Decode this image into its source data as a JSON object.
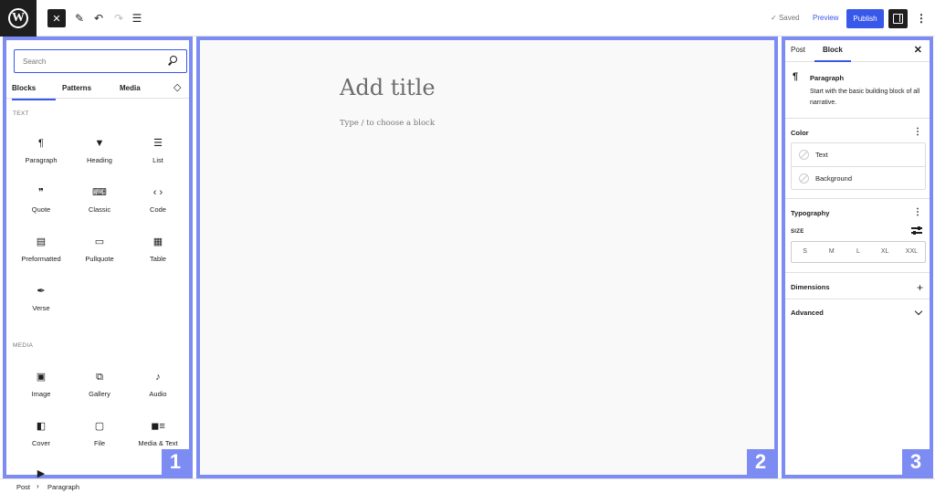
{
  "header": {
    "status": "Saved",
    "preview_label": "Preview",
    "publish_label": "Publish"
  },
  "inserter": {
    "search_placeholder": "Search",
    "tabs": [
      "Blocks",
      "Patterns",
      "Media"
    ],
    "sections": [
      {
        "title": "TEXT",
        "blocks": [
          {
            "label": "Paragraph",
            "icon": "paragraph-icon"
          },
          {
            "label": "Heading",
            "icon": "heading-icon"
          },
          {
            "label": "List",
            "icon": "list-icon"
          },
          {
            "label": "Quote",
            "icon": "quote-icon"
          },
          {
            "label": "Classic",
            "icon": "classic-keyboard-icon"
          },
          {
            "label": "Code",
            "icon": "code-icon"
          },
          {
            "label": "Preformatted",
            "icon": "preformatted-icon"
          },
          {
            "label": "Pullquote",
            "icon": "pullquote-icon"
          },
          {
            "label": "Table",
            "icon": "table-icon"
          },
          {
            "label": "Verse",
            "icon": "verse-quill-icon"
          }
        ]
      },
      {
        "title": "MEDIA",
        "blocks": [
          {
            "label": "Image",
            "icon": "image-icon"
          },
          {
            "label": "Gallery",
            "icon": "gallery-icon"
          },
          {
            "label": "Audio",
            "icon": "audio-note-icon"
          },
          {
            "label": "Cover",
            "icon": "cover-icon"
          },
          {
            "label": "File",
            "icon": "file-folder-icon"
          },
          {
            "label": "Media & Text",
            "icon": "media-text-icon"
          }
        ]
      }
    ]
  },
  "canvas": {
    "title_placeholder": "Add title",
    "body_placeholder": "Type / to choose a block"
  },
  "sidebar": {
    "tabs": [
      "Post",
      "Block"
    ],
    "block_name": "Paragraph",
    "block_description": "Start with the basic building block of all narrative.",
    "color_title": "Color",
    "color_items": [
      "Text",
      "Background"
    ],
    "typography_title": "Typography",
    "size_label": "SIZE",
    "sizes": [
      "S",
      "M",
      "L",
      "XL",
      "XXL"
    ],
    "dimensions_title": "Dimensions",
    "advanced_title": "Advanced"
  },
  "badges": [
    "1",
    "2",
    "3"
  ],
  "footer": {
    "breadcrumb": [
      "Post",
      "Paragraph"
    ]
  },
  "colors": {
    "accent": "#3858e9",
    "frame": "#7c8cf3",
    "dark": "#1e1e1e"
  }
}
